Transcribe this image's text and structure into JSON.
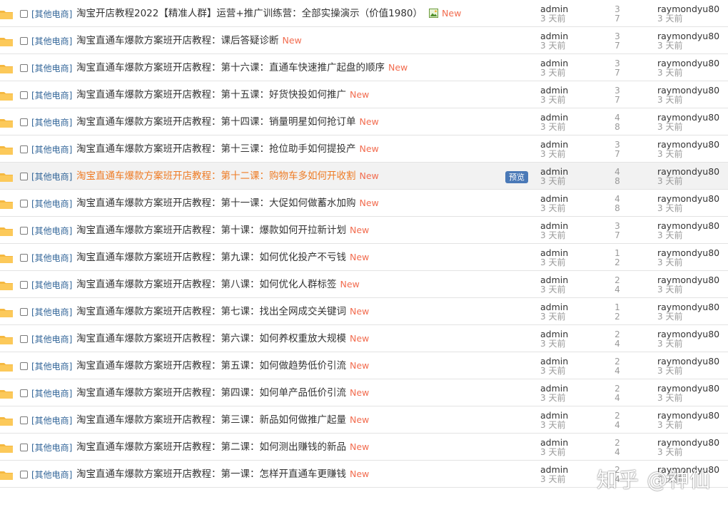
{
  "labels": {
    "new_tag": "New",
    "preview": "预览"
  },
  "colors": {
    "category": "#336699",
    "new_tag": "#f26c4f",
    "highlight_title": "#ee7b24",
    "preview_badge": "#4a79b7"
  },
  "icons": {
    "folder": "folder-icon",
    "attachment": "image-attachment-icon"
  },
  "watermark": "知乎 @神仙",
  "threads": [
    {
      "category": "[其他电商]",
      "title": "淘宝开店教程2022【精准人群】运营+推广训练营：全部实操演示（价值1980）",
      "attachment": true,
      "author": "admin",
      "date": "3 天前",
      "replies": "3",
      "views": "7",
      "last_poster": "raymondyu80",
      "last_date": "3 天前"
    },
    {
      "category": "[其他电商]",
      "title": "淘宝直通车爆款方案班开店教程：课后答疑诊断",
      "author": "admin",
      "date": "3 天前",
      "replies": "3",
      "views": "7",
      "last_poster": "raymondyu80",
      "last_date": "3 天前"
    },
    {
      "category": "[其他电商]",
      "title": "淘宝直通车爆款方案班开店教程：第十六课：直通车快速推广起盘的顺序",
      "author": "admin",
      "date": "3 天前",
      "replies": "3",
      "views": "7",
      "last_poster": "raymondyu80",
      "last_date": "3 天前"
    },
    {
      "category": "[其他电商]",
      "title": "淘宝直通车爆款方案班开店教程：第十五课：好货快投如何推广",
      "author": "admin",
      "date": "3 天前",
      "replies": "3",
      "views": "7",
      "last_poster": "raymondyu80",
      "last_date": "3 天前"
    },
    {
      "category": "[其他电商]",
      "title": "淘宝直通车爆款方案班开店教程：第十四课：销量明星如何抢订单",
      "author": "admin",
      "date": "3 天前",
      "replies": "4",
      "views": "8",
      "last_poster": "raymondyu80",
      "last_date": "3 天前"
    },
    {
      "category": "[其他电商]",
      "title": "淘宝直通车爆款方案班开店教程：第十三课：抢位助手如何提投产",
      "author": "admin",
      "date": "3 天前",
      "replies": "3",
      "views": "7",
      "last_poster": "raymondyu80",
      "last_date": "3 天前"
    },
    {
      "category": "[其他电商]",
      "title": "淘宝直通车爆款方案班开店教程：第十二课：购物车多如何开收割",
      "highlight": true,
      "preview": true,
      "author": "admin",
      "date": "3 天前",
      "replies": "4",
      "views": "8",
      "last_poster": "raymondyu80",
      "last_date": "3 天前"
    },
    {
      "category": "[其他电商]",
      "title": "淘宝直通车爆款方案班开店教程：第十一课：大促如何做蓄水加购",
      "author": "admin",
      "date": "3 天前",
      "replies": "4",
      "views": "8",
      "last_poster": "raymondyu80",
      "last_date": "3 天前"
    },
    {
      "category": "[其他电商]",
      "title": "淘宝直通车爆款方案班开店教程：第十课：爆款如何开拉新计划",
      "author": "admin",
      "date": "3 天前",
      "replies": "3",
      "views": "7",
      "last_poster": "raymondyu80",
      "last_date": "3 天前"
    },
    {
      "category": "[其他电商]",
      "title": "淘宝直通车爆款方案班开店教程：第九课：如何优化投产不亏钱",
      "author": "admin",
      "date": "3 天前",
      "replies": "1",
      "views": "2",
      "last_poster": "raymondyu80",
      "last_date": "3 天前"
    },
    {
      "category": "[其他电商]",
      "title": "淘宝直通车爆款方案班开店教程：第八课：如何优化人群标签",
      "author": "admin",
      "date": "3 天前",
      "replies": "2",
      "views": "4",
      "last_poster": "raymondyu80",
      "last_date": "3 天前"
    },
    {
      "category": "[其他电商]",
      "title": "淘宝直通车爆款方案班开店教程：第七课：找出全网成交关键词",
      "author": "admin",
      "date": "3 天前",
      "replies": "1",
      "views": "2",
      "last_poster": "raymondyu80",
      "last_date": "3 天前"
    },
    {
      "category": "[其他电商]",
      "title": "淘宝直通车爆款方案班开店教程：第六课：如何养权重放大规模",
      "author": "admin",
      "date": "3 天前",
      "replies": "2",
      "views": "4",
      "last_poster": "raymondyu80",
      "last_date": "3 天前"
    },
    {
      "category": "[其他电商]",
      "title": "淘宝直通车爆款方案班开店教程：第五课：如何做趋势低价引流",
      "author": "admin",
      "date": "3 天前",
      "replies": "2",
      "views": "4",
      "last_poster": "raymondyu80",
      "last_date": "3 天前"
    },
    {
      "category": "[其他电商]",
      "title": "淘宝直通车爆款方案班开店教程：第四课：如何单产品低价引流",
      "author": "admin",
      "date": "3 天前",
      "replies": "2",
      "views": "4",
      "last_poster": "raymondyu80",
      "last_date": "3 天前"
    },
    {
      "category": "[其他电商]",
      "title": "淘宝直通车爆款方案班开店教程：第三课：新品如何做推广起量",
      "author": "admin",
      "date": "3 天前",
      "replies": "2",
      "views": "4",
      "last_poster": "raymondyu80",
      "last_date": "3 天前"
    },
    {
      "category": "[其他电商]",
      "title": "淘宝直通车爆款方案班开店教程：第二课：如何测出赚钱的新品",
      "author": "admin",
      "date": "3 天前",
      "replies": "2",
      "views": "4",
      "last_poster": "raymondyu80",
      "last_date": "3 天前"
    },
    {
      "category": "[其他电商]",
      "title": "淘宝直通车爆款方案班开店教程：第一课：怎样开直通车更赚钱",
      "author": "admin",
      "date": "3 天前",
      "replies": "2",
      "views": "4",
      "last_poster": "raymondyu80",
      "last_date": "3 天前"
    }
  ]
}
